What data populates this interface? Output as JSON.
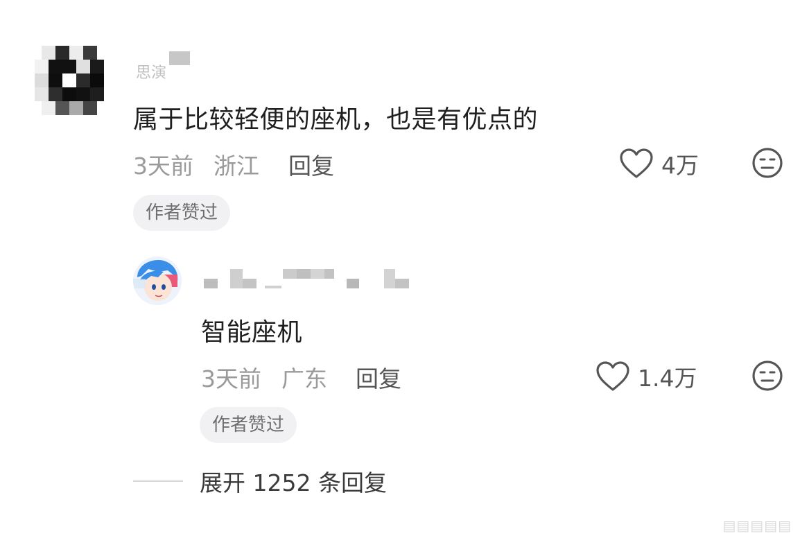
{
  "comments": [
    {
      "username": "思演",
      "text": "属于比较轻便的座机，也是有优点的",
      "time": "3天前",
      "location": "浙江",
      "reply_label": "回复",
      "likes": "4万",
      "badge": "作者赞过",
      "replies": [
        {
          "text": "智能座机",
          "time": "3天前",
          "location": "广东",
          "reply_label": "回复",
          "likes": "1.4万",
          "badge": "作者赞过"
        }
      ]
    }
  ],
  "expand": {
    "label": "展开 1252 条回复"
  },
  "icons": {
    "like": "heart-outline-icon",
    "dislike": "meh-face-icon"
  },
  "colors": {
    "meta_gray": "#9a9a9a",
    "text_dark": "#1f1f1f",
    "badge_bg": "#f1f1f3"
  }
}
